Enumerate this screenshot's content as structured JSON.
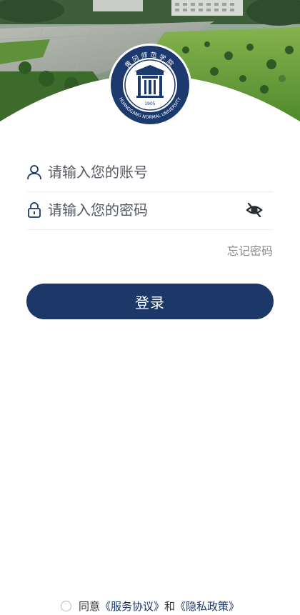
{
  "emblem": {
    "name_cn": "黄冈师范学院",
    "name_en": "HUANGGANG NORMAL UNIVERSITY",
    "year": "1905",
    "icon": "university-emblem"
  },
  "form": {
    "account": {
      "placeholder": "请输入您的账号",
      "value": "",
      "icon": "user-icon"
    },
    "password": {
      "placeholder": "请输入您的密码",
      "value": "",
      "icon": "lock-icon",
      "toggle_icon": "eye-off-icon"
    },
    "forgot_label": "忘记密码",
    "login_label": "登录"
  },
  "agreement": {
    "prefix": "同意",
    "service_link": "《服务协议》",
    "and": "和",
    "privacy_link": "《隐私政策》",
    "checked": false
  },
  "colors": {
    "primary": "#1c3869",
    "placeholder": "#555a63",
    "secondary_text": "#8a8a8a"
  }
}
